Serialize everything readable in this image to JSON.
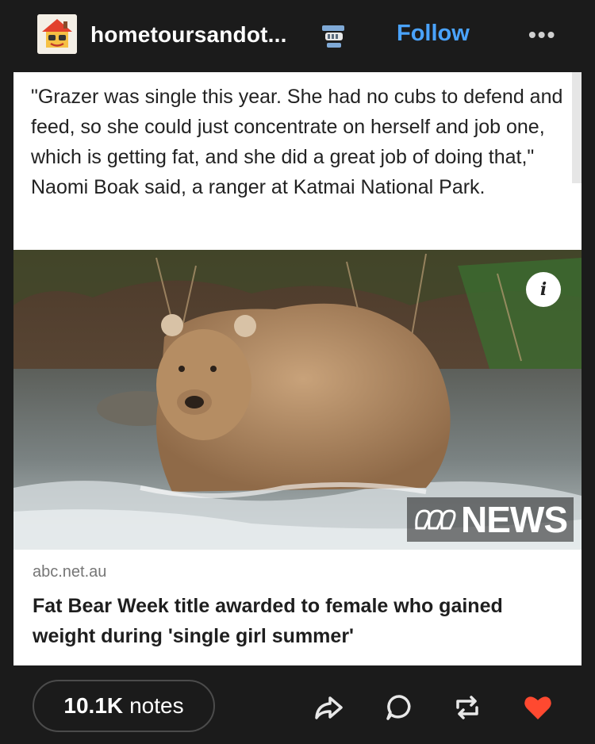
{
  "header": {
    "username": "hometoursandot...",
    "follow_label": "Follow",
    "more_label": "•••"
  },
  "post": {
    "quote": "\"Grazer was single this year. She had no cubs to defend and feed, so she could just concentrate on herself and job one, which is getting fat, and she did a great job of doing that,\" Naomi Boak said, a ranger at Katmai National Park.",
    "image": {
      "info_label": "i",
      "watermark": "NEWS"
    },
    "link": {
      "domain": "abc.net.au",
      "headline": "Fat Bear Week title awarded to female who gained weight during 'single girl summer'"
    }
  },
  "footer": {
    "notes_count": "10.1K",
    "notes_label": "notes",
    "icons": [
      "share-icon",
      "reply-icon",
      "reblog-icon",
      "like-icon"
    ],
    "like_color": "#ff4930"
  },
  "colors": {
    "background": "#1b1b1b",
    "accent": "#4aa3ff"
  }
}
